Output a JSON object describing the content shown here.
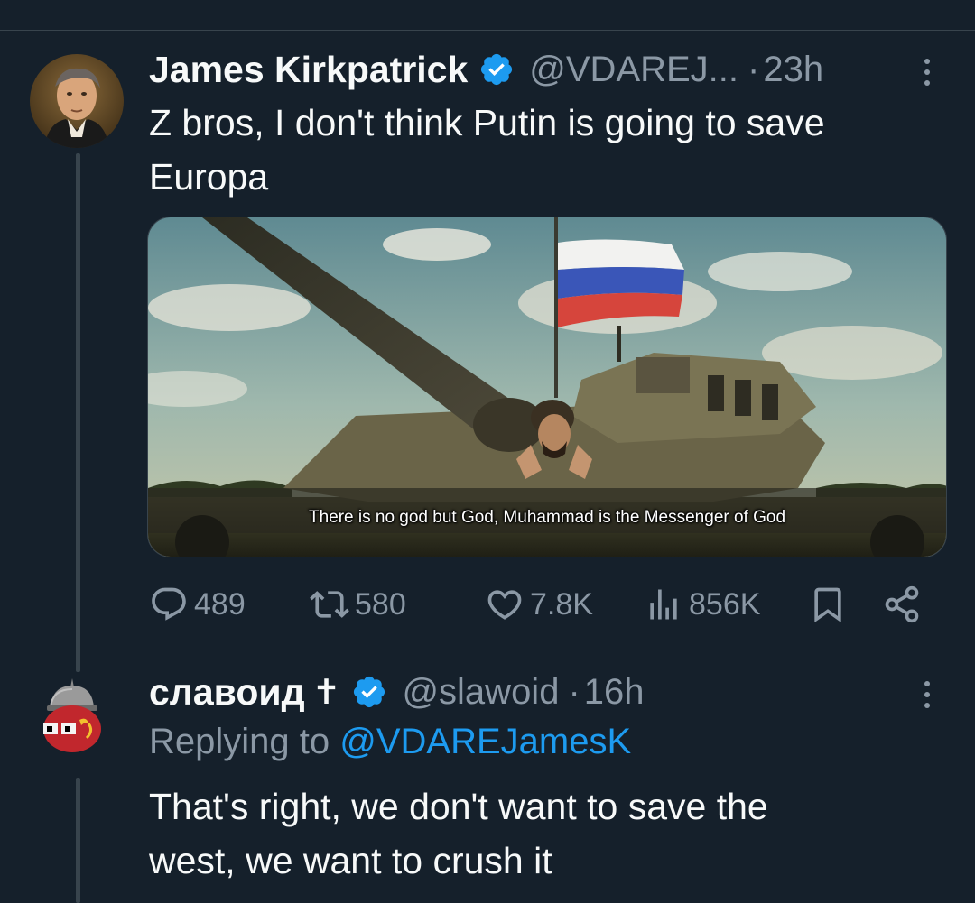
{
  "tweet": {
    "display_name": "James Kirkpatrick",
    "handle": "@VDAREJ...",
    "separator": "·",
    "time": "23h",
    "text_line1": "Z bros, I don't think Putin is going to save",
    "text_line2": "Europa",
    "media": {
      "subtitle": "There is no god but God, Muhammad is the Messenger of God"
    },
    "actions": {
      "replies": "489",
      "retweets": "580",
      "likes": "7.8K",
      "views": "856K"
    }
  },
  "reply": {
    "display_name": "славоид",
    "name_suffix": "✝",
    "handle": "@slawoid",
    "separator": "·",
    "time": "16h",
    "replying_prefix": "Replying to",
    "replying_to": "@VDAREJamesK",
    "text_line1": "That's right, we don't want to save the",
    "text_line2": "west, we want to crush it"
  },
  "colors": {
    "background": "#15202b",
    "accent": "#1d9bf0",
    "secondary_text": "#8b98a5",
    "primary_text": "#f7f9f9"
  },
  "icons": [
    "verified-badge-icon",
    "more-icon",
    "reply-icon",
    "retweet-icon",
    "like-icon",
    "views-icon",
    "bookmark-icon",
    "share-icon"
  ]
}
